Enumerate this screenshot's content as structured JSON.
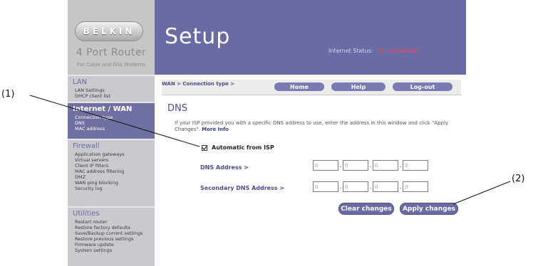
{
  "brand": {
    "logo_text": "BELKIN",
    "product_name": "4 Port Router",
    "product_sub": "For Cable and DSL Modems"
  },
  "banner": {
    "title": "Setup",
    "internet_status_label": "Internet Status:",
    "internet_status_value": "no connection"
  },
  "sidebar": {
    "sections": [
      {
        "heading": "LAN",
        "items": [
          "LAN Settings",
          "DHCP client list"
        ]
      },
      {
        "heading": "Internet / WAN",
        "items": [
          "Connection type",
          "DNS",
          "MAC address"
        ]
      },
      {
        "heading": "Firewall",
        "items": [
          "Application gateways",
          "Virtual servers",
          "Client IP filters",
          "MAC address filtering",
          "DMZ",
          "WAN ping blocking",
          "Security log"
        ]
      },
      {
        "heading": "Utilities",
        "items": [
          "Restart router",
          "Restore factory defaults",
          "Save/Backup current settings",
          "Restore previous settings",
          "Firmware update",
          "System settings"
        ]
      }
    ]
  },
  "topbar": {
    "breadcrumb": "WAN > Connection type >",
    "home": "Home",
    "help": "Help",
    "logout": "Log-out"
  },
  "main": {
    "title": "DNS",
    "intro": "If your ISP provided you with a specific DNS address to use, enter the address in this window and click \"Apply Changes\".",
    "more_info": "More Info",
    "auto_label": "Automatic from ISP",
    "dns_label": "DNS Address >",
    "dns_values": [
      "0",
      "0",
      "0",
      "0"
    ],
    "secondary_label": "Secondary DNS Address >",
    "secondary_values": [
      "0",
      "0",
      "0",
      "0"
    ],
    "clear_button": "Clear changes",
    "apply_button": "Apply changes"
  },
  "callouts": {
    "one": "(1)",
    "two": "(2)"
  },
  "colors": {
    "banner": "#6a6aa5",
    "status_alert": "#ff4a4a",
    "sidebar": "#c9c9cf",
    "sidebar_active": "#6f6fa2"
  },
  "icons": {
    "checkbox": "checkmark-icon"
  }
}
